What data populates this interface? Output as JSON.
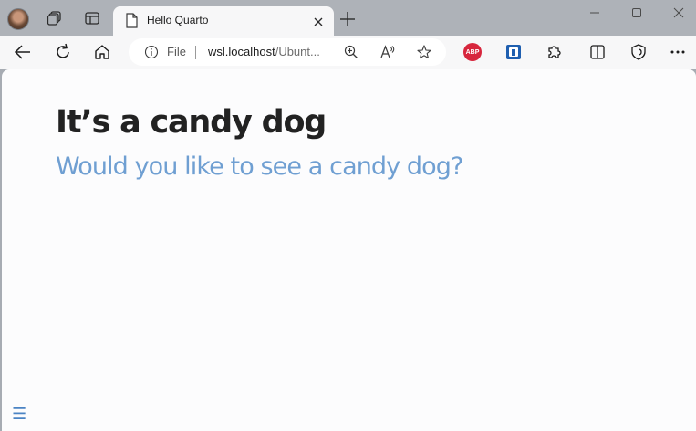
{
  "browser": {
    "tab": {
      "title": "Hello Quarto"
    },
    "address_bar": {
      "scheme_label": "File",
      "url_host": "wsl.localhost",
      "url_rest": "/Ubunt..."
    },
    "extensions": {
      "abp_label": "ABP"
    },
    "icons": [
      "profile-avatar",
      "workspaces-icon",
      "tab-actions-icon",
      "page-icon",
      "close-icon",
      "new-tab-icon",
      "minimize-icon",
      "maximize-icon",
      "window-close-icon",
      "back-icon",
      "refresh-icon",
      "home-icon",
      "info-icon",
      "zoom-icon",
      "read-aloud-icon",
      "favorite-icon",
      "adblock-icon",
      "password-extension-icon",
      "extensions-icon",
      "split-screen-icon",
      "browser-essentials-icon",
      "more-icon"
    ]
  },
  "content": {
    "title": "It’s a candy dog",
    "subtitle": "Would you like to see a candy dog?",
    "menu_toggle": "☰"
  },
  "colors": {
    "title": "#222222",
    "subtitle": "#6f9fd2",
    "menu_toggle": "#4b84c4",
    "chrome": "#aeb2b8",
    "toolbar": "#f7f7f8"
  }
}
